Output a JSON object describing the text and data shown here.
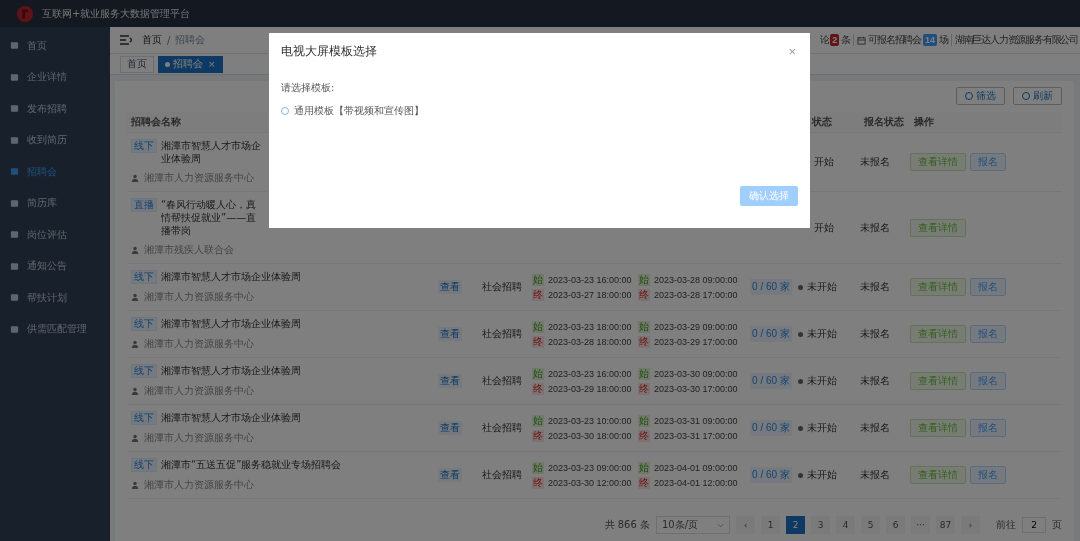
{
  "app": {
    "title": "互联网+就业服务大数据管理平台"
  },
  "sidebar": {
    "items": [
      {
        "label": "首页",
        "selected": false
      },
      {
        "label": "企业详情",
        "selected": false
      },
      {
        "label": "发布招聘",
        "selected": false
      },
      {
        "label": "收到简历",
        "selected": false
      },
      {
        "label": "招聘会",
        "selected": true
      },
      {
        "label": "简历库",
        "selected": false
      },
      {
        "label": "岗位评估",
        "selected": false
      },
      {
        "label": "通知公告",
        "selected": false
      },
      {
        "label": "帮扶计划",
        "selected": false
      },
      {
        "label": "供需匹配管理",
        "selected": false
      }
    ]
  },
  "breadcrumb": {
    "items": [
      "首页",
      "招聘会"
    ],
    "separator": "/"
  },
  "header_stats": {
    "comments_label": "论",
    "comments_count": "2",
    "comments_unit": "条",
    "fairs_label": "可报名招聘会",
    "fairs_count": "14",
    "fairs_unit": "场",
    "company": "湖南巨达人力资源服务有限公司"
  },
  "tags": [
    {
      "label": "首页",
      "selected": false
    },
    {
      "label": "招聘会",
      "selected": true,
      "close": "×"
    }
  ],
  "toolbar": [
    "筛选",
    "刷新"
  ],
  "table": {
    "headers": {
      "name": "招聘会名称",
      "activity_status": "状态",
      "signup_status": "报名状态",
      "actions": "操作"
    },
    "rows": [
      {
        "tag": "线下",
        "name": "湘潭市智慧人才市场企业体验周",
        "org": "湘潭市人力资源服务中心",
        "status": "开始",
        "signup_status": "未报名",
        "actions": [
          {
            "label": "查看详情",
            "kind": "detail"
          },
          {
            "label": "报名",
            "kind": "signup"
          }
        ]
      },
      {
        "tag": "直播",
        "name": "“春风行动暖人心，真情帮扶促就业”——直播带岗",
        "org": "湘潭市残疾人联合会",
        "status": "开始",
        "signup_status": "未报名",
        "actions": [
          {
            "label": "查看详情",
            "kind": "detail"
          }
        ]
      },
      {
        "tag": "线下",
        "name": "湘潭市智慧人才市场企业体验周",
        "org": "湘潭市人力资源服务中心",
        "view": "查看",
        "type": "社会招聘",
        "signup": [
          {
            "tag": "始",
            "kind": "start",
            "time": "2023-03-23 16:00:00"
          },
          {
            "tag": "终",
            "kind": "end",
            "time": "2023-03-27 18:00:00"
          }
        ],
        "event": [
          {
            "tag": "始",
            "kind": "start",
            "time": "2023-03-28 09:00:00"
          },
          {
            "tag": "终",
            "kind": "end",
            "time": "2023-03-28 17:00:00"
          }
        ],
        "capacity": "0 / 60 家",
        "status": "未开始",
        "signup_status": "未报名",
        "actions": [
          {
            "label": "查看详情",
            "kind": "detail"
          },
          {
            "label": "报名",
            "kind": "signup"
          }
        ]
      },
      {
        "tag": "线下",
        "name": "湘潭市智慧人才市场企业体验周",
        "org": "湘潭市人力资源服务中心",
        "view": "查看",
        "type": "社会招聘",
        "signup": [
          {
            "tag": "始",
            "kind": "start",
            "time": "2023-03-23 18:00:00"
          },
          {
            "tag": "终",
            "kind": "end",
            "time": "2023-03-28 18:00:00"
          }
        ],
        "event": [
          {
            "tag": "始",
            "kind": "start",
            "time": "2023-03-29 09:00:00"
          },
          {
            "tag": "终",
            "kind": "end",
            "time": "2023-03-29 17:00:00"
          }
        ],
        "capacity": "0 / 60 家",
        "status": "未开始",
        "signup_status": "未报名",
        "actions": [
          {
            "label": "查看详情",
            "kind": "detail"
          },
          {
            "label": "报名",
            "kind": "signup"
          }
        ]
      },
      {
        "tag": "线下",
        "name": "湘潭市智慧人才市场企业体验周",
        "org": "湘潭市人力资源服务中心",
        "view": "查看",
        "type": "社会招聘",
        "signup": [
          {
            "tag": "始",
            "kind": "start",
            "time": "2023-03-23 16:00:00"
          },
          {
            "tag": "终",
            "kind": "end",
            "time": "2023-03-29 18:00:00"
          }
        ],
        "event": [
          {
            "tag": "始",
            "kind": "start",
            "time": "2023-03-30 09:00:00"
          },
          {
            "tag": "终",
            "kind": "end",
            "time": "2023-03-30 17:00:00"
          }
        ],
        "capacity": "0 / 60 家",
        "status": "未开始",
        "signup_status": "未报名",
        "actions": [
          {
            "label": "查看详情",
            "kind": "detail"
          },
          {
            "label": "报名",
            "kind": "signup"
          }
        ]
      },
      {
        "tag": "线下",
        "name": "湘潭市智慧人才市场企业体验周",
        "org": "湘潭市人力资源服务中心",
        "view": "查看",
        "type": "社会招聘",
        "signup": [
          {
            "tag": "始",
            "kind": "start",
            "time": "2023-03-23 10:00:00"
          },
          {
            "tag": "终",
            "kind": "end",
            "time": "2023-03-30 18:00:00"
          }
        ],
        "event": [
          {
            "tag": "始",
            "kind": "start",
            "time": "2023-03-31 09:00:00"
          },
          {
            "tag": "终",
            "kind": "end",
            "time": "2023-03-31 17:00:00"
          }
        ],
        "capacity": "0 / 60 家",
        "status": "未开始",
        "signup_status": "未报名",
        "actions": [
          {
            "label": "查看详情",
            "kind": "detail"
          },
          {
            "label": "报名",
            "kind": "signup"
          }
        ]
      },
      {
        "tag": "线下",
        "name": "湘潭市“五送五促”服务稳就业专场招聘会",
        "org": "湘潭市人力资源服务中心",
        "view": "查看",
        "type": "社会招聘",
        "signup": [
          {
            "tag": "始",
            "kind": "start",
            "time": "2023-03-23 09:00:00"
          },
          {
            "tag": "终",
            "kind": "end",
            "time": "2023-03-30 12:00:00"
          }
        ],
        "event": [
          {
            "tag": "始",
            "kind": "start",
            "time": "2023-04-01 09:00:00"
          },
          {
            "tag": "终",
            "kind": "end",
            "time": "2023-04-01 12:00:00"
          }
        ],
        "capacity": "0 / 60 家",
        "status": "未开始",
        "signup_status": "未报名",
        "actions": [
          {
            "label": "查看详情",
            "kind": "detail"
          },
          {
            "label": "报名",
            "kind": "signup"
          }
        ]
      }
    ]
  },
  "pagination": {
    "total": "共 866 条",
    "page_size": "10条/页",
    "prev": "‹",
    "next": "›",
    "pages": [
      {
        "label": "1",
        "selected": false
      },
      {
        "label": "2",
        "selected": true
      },
      {
        "label": "3",
        "selected": false
      },
      {
        "label": "4",
        "selected": false
      },
      {
        "label": "5",
        "selected": false
      },
      {
        "label": "6",
        "selected": false
      },
      {
        "label": "···",
        "selected": false
      },
      {
        "label": "87",
        "selected": false
      }
    ],
    "goto_label": "前往",
    "goto_value": "2",
    "goto_unit": "页"
  },
  "modal": {
    "title": "电视大屏模板选择",
    "close": "×",
    "prompt": "请选择模板:",
    "options": [
      {
        "label": "通用模板【带视频和宣传图】",
        "selected": false
      }
    ],
    "confirm": {
      "label": "确认选择",
      "disabled": true
    }
  }
}
